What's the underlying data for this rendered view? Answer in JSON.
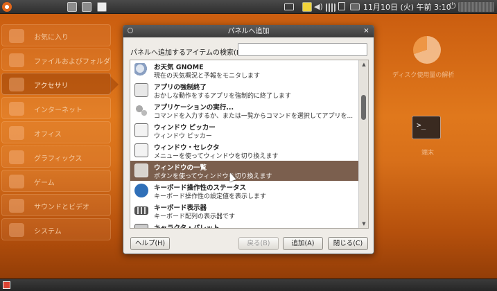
{
  "top_panel": {
    "clock": "11月10日 (火) 午前 3:10",
    "icons": [
      "ubuntu-logo-icon",
      "window-icon",
      "window-icon",
      "terminal-icon",
      "mail-icon",
      "note-icon",
      "volume-icon",
      "signal-icon",
      "battery-icon",
      "network-icon",
      "power-icon"
    ],
    "volume_glyph": "◀)"
  },
  "sidebar": {
    "items": [
      {
        "label": "お気に入り",
        "icon": "star-icon"
      },
      {
        "label": "ファイルおよびフォルダ",
        "icon": "folder-icon"
      },
      {
        "label": "アクセサリ",
        "icon": "accessories-icon",
        "active": true
      },
      {
        "label": "インターネット",
        "icon": "globe-icon"
      },
      {
        "label": "オフィス",
        "icon": "office-icon"
      },
      {
        "label": "グラフィックス",
        "icon": "graphics-icon"
      },
      {
        "label": "ゲーム",
        "icon": "game-icon"
      },
      {
        "label": "サウンドとビデオ",
        "icon": "media-icon"
      },
      {
        "label": "システム",
        "icon": "gear-icon"
      }
    ]
  },
  "background_tiles": {
    "disk_label": "ディスク使用量の解析",
    "terminal_label": "端末",
    "terminal_prompt": ">_"
  },
  "dialog": {
    "title": "パネルへ追加",
    "close_glyph": "×",
    "search_label": "パネルへ追加するアイテムの検索(I):",
    "search_value": "",
    "items": [
      {
        "title": "お天気 GNOME",
        "desc": "現在の天気概況と予報をモニタします",
        "icon": "weather-icon"
      },
      {
        "title": "アプリの強制終了",
        "desc": "おかしな動作をするアプリを強制的に終了します",
        "icon": "force-quit-icon"
      },
      {
        "title": "アプリケーションの実行...",
        "desc": "コマンドを入力するか、または一覧からコマンドを選択してアプリを...",
        "icon": "run-app-icon"
      },
      {
        "title": "ウィンドウ ピッカー",
        "desc": "ウィンドウ ピッカー",
        "icon": "window-picker-icon"
      },
      {
        "title": "ウィンドウ・セレクタ",
        "desc": "メニューを使ってウィンドウを切り換えます",
        "icon": "window-selector-icon"
      },
      {
        "title": "ウィンドウの一覧",
        "desc": "ボタンを使ってウィンドウを切り換えます",
        "icon": "window-list-icon",
        "selected": true
      },
      {
        "title": "キーボード操作性のステータス",
        "desc": "キーボード操作性の設定値を表示します",
        "icon": "accessibility-icon"
      },
      {
        "title": "キーボード表示器",
        "desc": "キーボード配列の表示器です",
        "icon": "keyboard-icon"
      },
      {
        "title": "キャラクタ・パレット",
        "desc": "",
        "icon": "charpalette-icon"
      }
    ],
    "buttons": {
      "help": "ヘルプ(H)",
      "back": "戻る(B)",
      "add": "追加(A)",
      "close": "閉じる(C)"
    }
  },
  "colors": {
    "desktop_orange": "#d8701a",
    "selection": "#7b5f4e",
    "panel_dark": "#2f2f2f"
  }
}
